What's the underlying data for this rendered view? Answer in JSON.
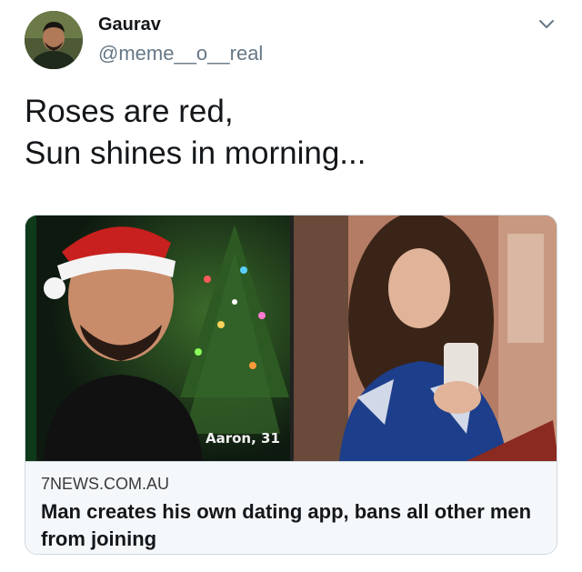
{
  "tweet": {
    "author_name": "Gaurav",
    "author_handle": "@meme__o__real",
    "text_line_1": "Roses are red,",
    "text_line_2": "Sun shines in morning...",
    "menu_icon": "chevron-down-icon",
    "avatar_icon": "avatar"
  },
  "card": {
    "image_caption": "Aaron, 31",
    "domain": "7NEWS.COM.AU",
    "headline": "Man creates his own dating app, bans all other men from joining"
  },
  "colors": {
    "handle": "#657786",
    "card_border": "#cfd9de",
    "card_meta_bg": "#f5f8fa"
  }
}
